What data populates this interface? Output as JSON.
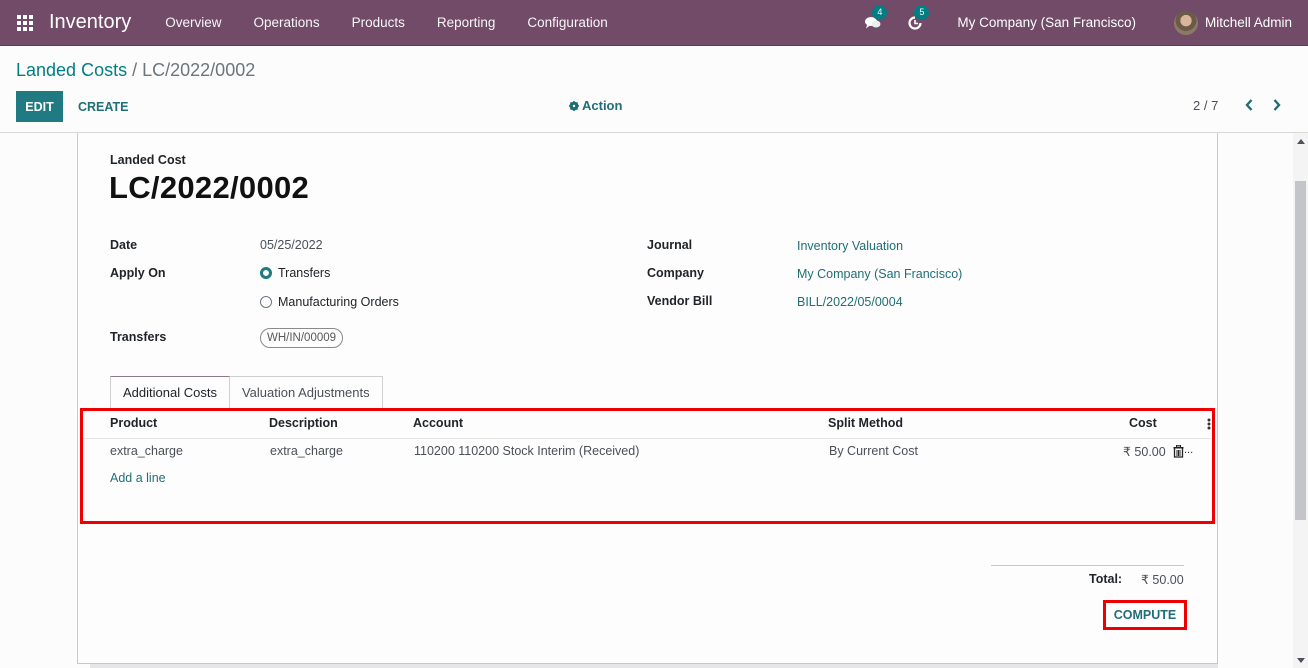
{
  "navbar": {
    "app_name": "Inventory",
    "menu": [
      "Overview",
      "Operations",
      "Products",
      "Reporting",
      "Configuration"
    ],
    "messages_count": "4",
    "activities_count": "5",
    "company": "My Company (San Francisco)",
    "user": "Mitchell Admin",
    "bg_color": "#714b67"
  },
  "control_panel": {
    "breadcrumb_parent": "Landed Costs",
    "breadcrumb_separator": "/",
    "breadcrumb_current": "LC/2022/0002",
    "edit_label": "EDIT",
    "create_label": "CREATE",
    "action_label": "Action",
    "pager": "2 / 7"
  },
  "record": {
    "type_label": "Landed Cost",
    "name": "LC/2022/0002",
    "left_fields": {
      "date_label": "Date",
      "date_value": "05/25/2022",
      "apply_on_label": "Apply On",
      "apply_on_options": [
        {
          "label": "Transfers",
          "checked": true
        },
        {
          "label": "Manufacturing Orders",
          "checked": false
        }
      ],
      "transfers_label": "Transfers",
      "transfers_tag": "WH/IN/00009"
    },
    "right_fields": {
      "journal_label": "Journal",
      "journal_value": "Inventory Valuation",
      "company_label": "Company",
      "company_value": "My Company (San Francisco)",
      "vendor_bill_label": "Vendor Bill",
      "vendor_bill_value": "BILL/2022/05/0004"
    }
  },
  "tabs": [
    {
      "label": "Additional Costs",
      "active": true
    },
    {
      "label": "Valuation Adjustments",
      "active": false
    }
  ],
  "cost_lines": {
    "columns": [
      "Product",
      "Description",
      "Account",
      "Split Method",
      "Cost"
    ],
    "rows": [
      {
        "product": "extra_charge",
        "description": "extra_charge",
        "account": "110200 110200 Stock Interim (Received)",
        "split_method": "By Current Cost",
        "cost": "₹ 50.00"
      }
    ],
    "add_line_label": "Add a line",
    "row_overflow": "..."
  },
  "totals": {
    "total_label": "Total:",
    "total_value": "₹ 50.00",
    "compute_label": "COMPUTE"
  },
  "colors": {
    "accent": "#017e84",
    "highlight": "#ee0000"
  }
}
